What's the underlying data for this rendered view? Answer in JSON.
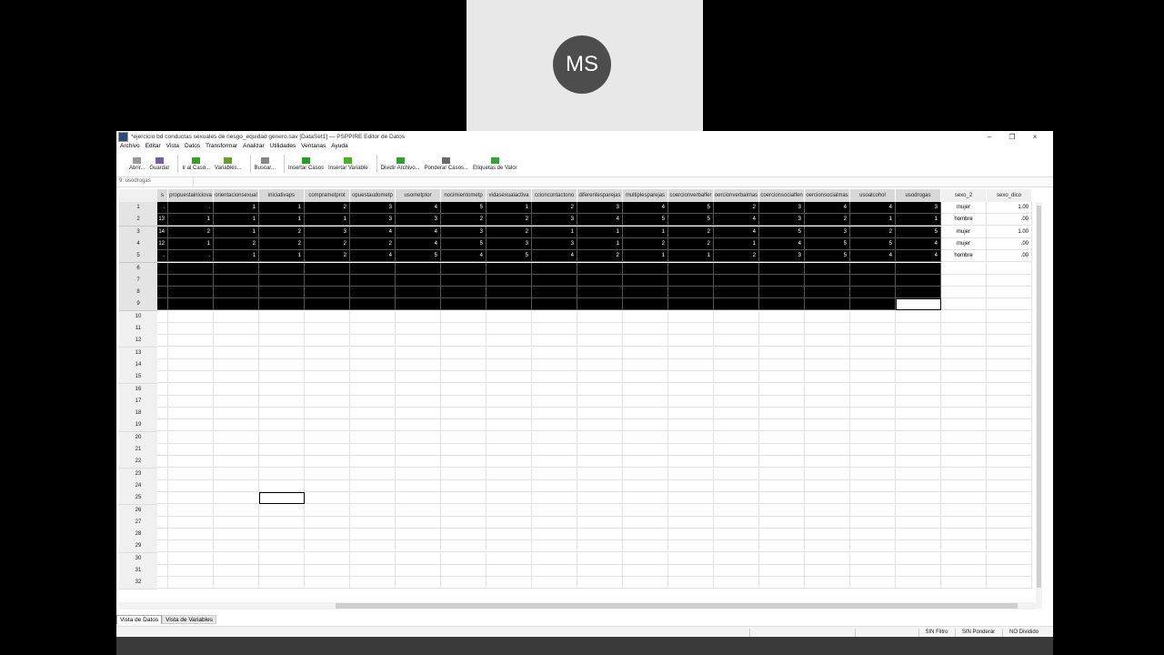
{
  "presenter": {
    "initials": "MS"
  },
  "window": {
    "title": "*ejercicio bd conductas sexuales de riesgo_equidad genero.sav [DataSet1] — PSPPIRE Editor de Datos",
    "controls": {
      "minimize": "–",
      "maximize": "❐",
      "close": "×"
    }
  },
  "menu": [
    "Archivo",
    "Editar",
    "Vista",
    "Datos",
    "Transformar",
    "Analizar",
    "Utilidades",
    "Ventanas",
    "Ayuda"
  ],
  "toolbar": [
    {
      "label": "Abrir...",
      "icon": "folder-open-icon",
      "color": "#9a9a9a"
    },
    {
      "label": "Guardar",
      "icon": "save-icon",
      "color": "#7a5aa8"
    },
    {
      "label": "Ir al Caso...",
      "icon": "goto-case-icon",
      "color": "#3a9a2a"
    },
    {
      "label": "Variables...",
      "icon": "variables-icon",
      "color": "#6a9a3a"
    },
    {
      "label": "Buscar...",
      "icon": "search-icon",
      "color": "#888888"
    },
    {
      "label": "Insertar Casos",
      "icon": "insert-cases-icon",
      "color": "#2a9a2a"
    },
    {
      "label": "Insertar Variable",
      "icon": "insert-variable-icon",
      "color": "#4ab02a"
    },
    {
      "label": "Dividir Archivo...",
      "icon": "split-file-icon",
      "color": "#3a9a3a"
    },
    {
      "label": "Ponderar Casos...",
      "icon": "weight-cases-icon",
      "color": "#6a6a6a"
    },
    {
      "label": "Etiquetas de Valor",
      "icon": "value-labels-icon",
      "color": "#3aa03a"
    }
  ],
  "cell_ref": "9: usodrogas",
  "columns": [
    "s",
    "propuestainiciova",
    "orientacionsexual",
    "iniciativaps",
    "comprametprot",
    "opuestaudometp",
    "usometptor",
    "nocimientometp",
    "vidasexualactiva",
    "ccioncontactono",
    "diferentesparejas",
    "multiplesparejas",
    "coercionverbalfer",
    "oercionverbalmas",
    "coercionsocialfen",
    "oercionsocialmas",
    "usoalcohol",
    "usodrogas",
    "sexo_2",
    "sexo_dico"
  ],
  "rows": [
    [
      ".",
      ".",
      "1",
      "1",
      "2",
      "3",
      "4",
      "5",
      "1",
      "2",
      "3",
      "4",
      "5",
      "2",
      "3",
      "4",
      "4",
      "3",
      "mujer",
      "1.00"
    ],
    [
      "13",
      "1",
      "1",
      "1",
      "1",
      "3",
      "3",
      "2",
      "2",
      "3",
      "4",
      "5",
      "5",
      "4",
      "3",
      "2",
      "1",
      "1",
      "hombre",
      ".00"
    ],
    [
      "14",
      "2",
      "1",
      "2",
      "3",
      "4",
      "4",
      "3",
      "2",
      "1",
      "1",
      "1",
      "2",
      "4",
      "5",
      "3",
      "2",
      "5",
      "mujer",
      "1.00"
    ],
    [
      "12",
      "1",
      "2",
      "2",
      "2",
      "2",
      "4",
      "5",
      "3",
      "3",
      "1",
      "2",
      "2",
      "1",
      "4",
      "5",
      "5",
      "4",
      "mujer",
      ".00"
    ],
    [
      ".",
      ".",
      "1",
      "1",
      "2",
      "4",
      "5",
      "4",
      "5",
      "4",
      "2",
      "1",
      "1",
      "2",
      "3",
      "5",
      "4",
      "4",
      "hombre",
      ".00"
    ]
  ],
  "row_numbers": [
    "1",
    "2",
    "3",
    "4",
    "5",
    "6",
    "7",
    "8",
    "9",
    "10",
    "11",
    "12",
    "13",
    "14",
    "15",
    "16",
    "17",
    "18",
    "19",
    "20",
    "21",
    "22",
    "23",
    "24",
    "25",
    "26",
    "27",
    "28",
    "29",
    "30",
    "31",
    "32"
  ],
  "tabs": [
    "Vista de Datos",
    "Vista de Variables"
  ],
  "status": [
    "SIN Filtro",
    "SIN Ponderar",
    "NO Dividido"
  ]
}
